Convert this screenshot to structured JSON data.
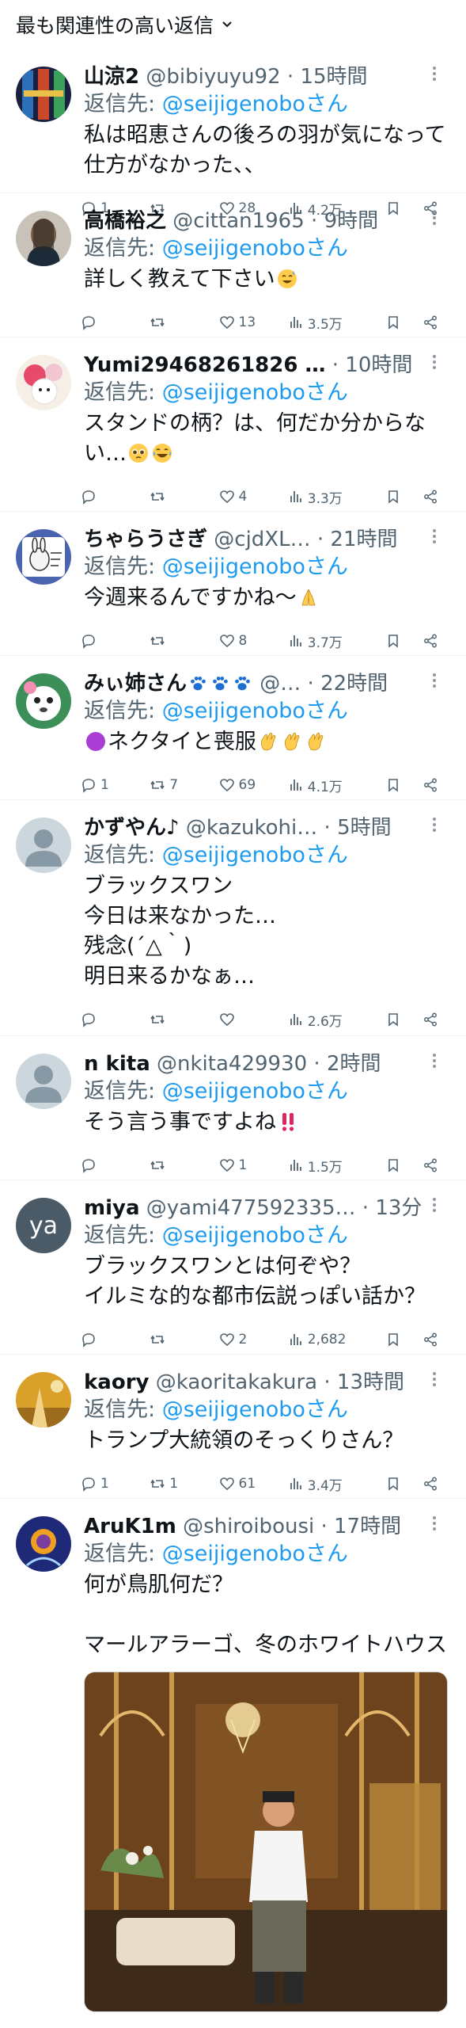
{
  "header": {
    "sort_label": "最も関連性の高い返信"
  },
  "reply_prefix": "返信先:",
  "replies": [
    {
      "name": "山涼2",
      "handle": "@bibiyuyu92",
      "time": "15時間",
      "to": "@seijigenoboさん",
      "text": "私は昭恵さんの後ろの羽が気になって仕方がなかった、、",
      "reply_count": "1",
      "retweet_count": "",
      "like_count": "28",
      "view_count": "4.2万"
    },
    {
      "name": "高橋裕之",
      "handle": "@cittan1965",
      "time": "9時間",
      "to": "@seijigenoboさん",
      "text": "詳しく教えて下さい",
      "reply_count": "",
      "retweet_count": "",
      "like_count": "13",
      "view_count": "3.5万"
    },
    {
      "name": "Yumi29468261826 …",
      "handle": "",
      "time": "10時間",
      "to": "@seijigenoboさん",
      "text": "スタンドの柄？は、何だか分からない…",
      "reply_count": "",
      "retweet_count": "",
      "like_count": "4",
      "view_count": "3.3万"
    },
    {
      "name": "ちゃらうさぎ",
      "handle": "@cjdXL…",
      "time": "21時間",
      "to": "@seijigenoboさん",
      "text": "今週来るんですかね〜",
      "reply_count": "",
      "retweet_count": "",
      "like_count": "8",
      "view_count": "3.7万"
    },
    {
      "name": "みぃ姉さん",
      "handle": "@…",
      "time": "22時間",
      "to": "@seijigenoboさん",
      "text": "ネクタイと喪服",
      "reply_count": "1",
      "retweet_count": "7",
      "like_count": "69",
      "view_count": "4.1万"
    },
    {
      "name": "かずやん♪",
      "handle": "@kazukohi…",
      "time": "5時間",
      "to": "@seijigenoboさん",
      "text": "ブラックスワン\n今日は来なかった…\n残念(´△｀)\n明日来るかなぁ…",
      "reply_count": "",
      "retweet_count": "",
      "like_count": "",
      "view_count": "2.6万"
    },
    {
      "name": "n kita",
      "handle": "@nkita429930",
      "time": "2時間",
      "to": "@seijigenoboさん",
      "text": "そう言う事ですよね",
      "reply_count": "",
      "retweet_count": "",
      "like_count": "1",
      "view_count": "1.5万"
    },
    {
      "name": "miya",
      "handle": "@yami477592335…",
      "time": "13分",
      "to": "@seijigenoboさん",
      "text": "ブラックスワンとは何ぞや？\nイルミな的な都市伝説っぽい話か？",
      "reply_count": "",
      "retweet_count": "",
      "like_count": "2",
      "view_count": "2,682",
      "avatar_text": "ya"
    },
    {
      "name": "kaory",
      "handle": "@kaoritakakura",
      "time": "13時間",
      "to": "@seijigenoboさん",
      "text": "トランプ大統領のそっくりさん？",
      "reply_count": "1",
      "retweet_count": "1",
      "like_count": "61",
      "view_count": "3.4万"
    },
    {
      "name": "AruK1m",
      "handle": "@shiroibousi",
      "time": "17時間",
      "to": "@seijigenoboさん",
      "text": "何が鳥肌何だ？\n\nマールアラーゴ、冬のホワイトハウス"
    }
  ],
  "colors": {
    "link": "#1d9bf0",
    "muted": "#536471",
    "text": "#0f1419",
    "divider": "#eff3f4",
    "crimson": "#e0245e"
  }
}
